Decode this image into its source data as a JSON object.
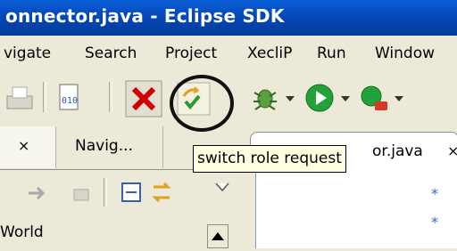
{
  "window": {
    "title": "onnector.java - Eclipse SDK"
  },
  "menu": [
    {
      "id": "navigate",
      "label": "vigate"
    },
    {
      "id": "search",
      "label": "Search"
    },
    {
      "id": "project",
      "label": "Project"
    },
    {
      "id": "xeclip",
      "label": "XecliP"
    },
    {
      "id": "run",
      "label": "Run"
    },
    {
      "id": "window",
      "label": "Window"
    }
  ],
  "toolbar": {
    "icons": [
      "print-icon",
      "binary-file-icon",
      "delete-icon",
      "switch-role-icon",
      "bug-icon",
      "run-icon",
      "external-tools-icon"
    ],
    "tooltip": "switch role request"
  },
  "left_panel": {
    "tab_navigator": "Navig...",
    "tree_item": "World"
  },
  "editor": {
    "tab_label": "or.java",
    "comment_marker": "*"
  }
}
